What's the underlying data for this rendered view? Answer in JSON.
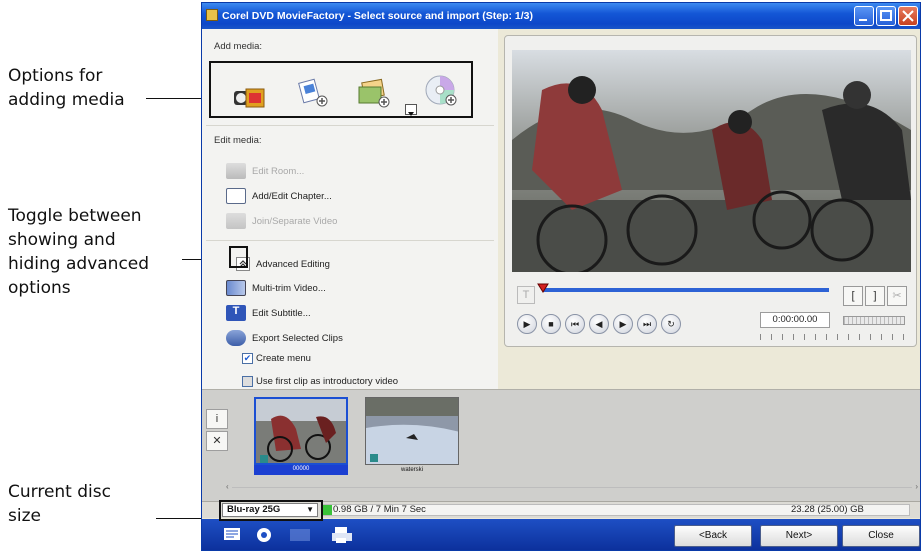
{
  "annotations": {
    "adding_media": [
      "Options for",
      "adding media"
    ],
    "toggle": [
      "Toggle between",
      "showing and",
      "hiding advanced",
      "options"
    ],
    "disc_size": [
      "Current disc",
      "size"
    ]
  },
  "window": {
    "title": "Corel DVD MovieFactory - Select source and import (Step: 1/3)"
  },
  "left": {
    "add_media_label": "Add media:",
    "edit_media_label": "Edit media:",
    "edit_items": [
      {
        "label": "Edit Room...",
        "icon": "edit-room-icon",
        "enabled": false
      },
      {
        "label": "Add/Edit Chapter...",
        "icon": "chapter-icon",
        "enabled": true
      },
      {
        "label": "Join/Separate Video",
        "icon": "join-video-icon",
        "enabled": false
      }
    ],
    "advanced_label": "Advanced Editing",
    "advanced_items": [
      {
        "label": "Multi-trim Video...",
        "icon": "multi-trim-icon"
      },
      {
        "label": "Edit Subtitle...",
        "icon": "subtitle-icon"
      },
      {
        "label": "Export Selected Clips",
        "icon": "export-clips-icon"
      }
    ],
    "create_menu_label": "Create menu",
    "create_menu_checked": true,
    "intro_label": "Use first clip as introductory video",
    "intro_checked": false
  },
  "player": {
    "timecode": "0:00:00.00"
  },
  "clips": [
    {
      "caption": "00000",
      "selected": true
    },
    {
      "caption": "waterski",
      "selected": false
    }
  ],
  "status": {
    "disc": "Blu-ray 25G",
    "used": "0.98 GB / 7 Min 7 Sec",
    "total": "23.28 (25.00) GB",
    "accent": "#39c239"
  },
  "buttons": {
    "back": "<Back",
    "next": "Next>",
    "close": "Close"
  }
}
